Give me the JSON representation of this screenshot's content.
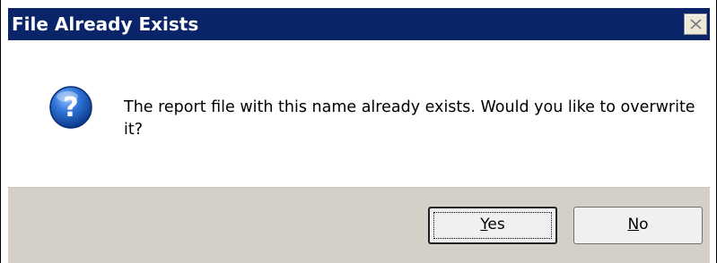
{
  "dialog": {
    "title": "File Already Exists",
    "close_icon": "close-icon",
    "message_icon": "question-icon",
    "message": "The report file with this name already exists. Would you like to overwrite it?",
    "buttons": {
      "yes": {
        "label": "Yes",
        "mnemonic": "Y",
        "rest": "es"
      },
      "no": {
        "label": "No",
        "mnemonic": "N",
        "rest": "o"
      }
    },
    "colors": {
      "titlebar": "#0a246a",
      "title_text": "#ffffff",
      "button_bar": "#d4d0c8",
      "icon_blue": "#1f5fbf"
    }
  }
}
